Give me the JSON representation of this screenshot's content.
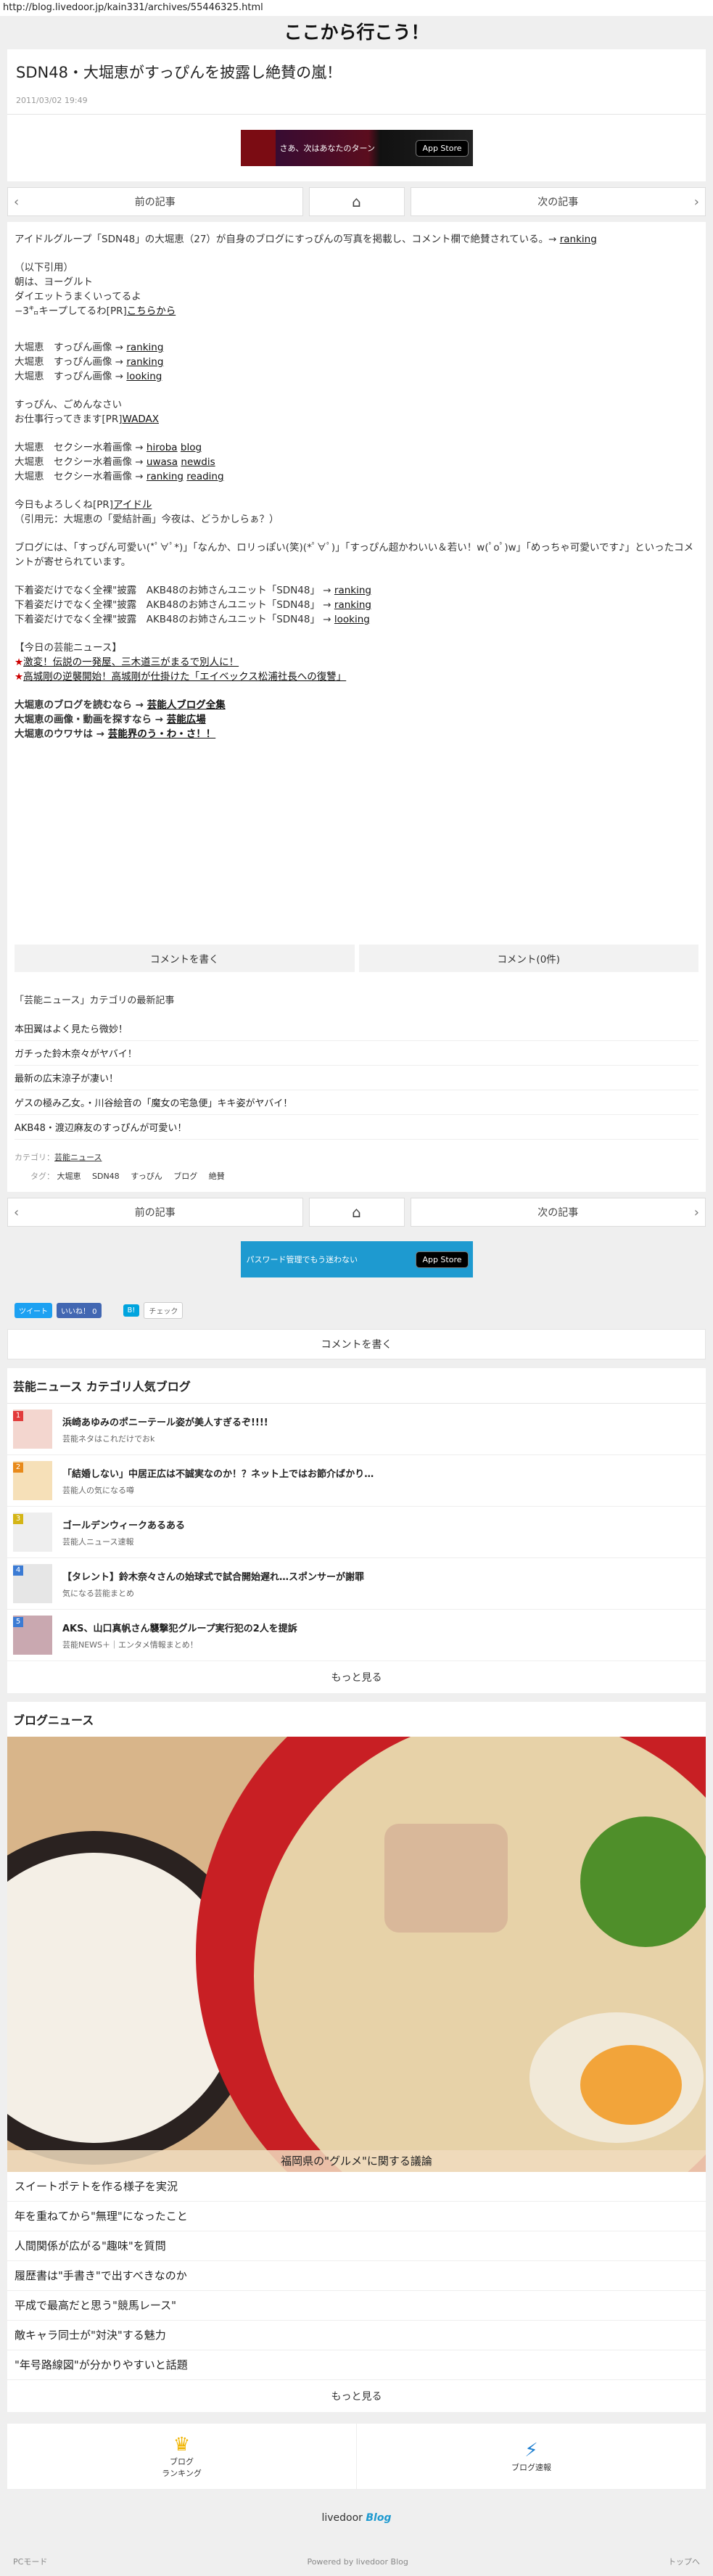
{
  "browser": {
    "url": "http://blog.livedoor.jp/kain331/archives/55446325.html"
  },
  "blog": {
    "title": "ここから行こう！"
  },
  "article": {
    "title": "SDN48・大堀恵がすっぴんを披露し絶賛の嵐！",
    "date": "2011/03/02 19:49"
  },
  "ads": {
    "top": {
      "text": "さあ、次はあなたのターン",
      "store": "App Store"
    },
    "bottom": {
      "text": "パスワード管理でもう迷わない",
      "store": "App Store"
    }
  },
  "pager": {
    "prev": "前の記事",
    "next": "次の記事",
    "home_icon": "home-icon"
  },
  "body": {
    "intro": "アイドルグループ「SDN48」の大堀恵（27）が自身のブログにすっぴんの写真を掲載し、コメント欄で絶賛されている。→",
    "intro_link": "ranking",
    "quote_head": "（以下引用）",
    "quote_1": "朝は、ヨーグルト",
    "quote_2": "ダイエットうまくいってるよ",
    "quote_3": "−3㌔キープしてるわ[PR]",
    "quote_3_link": "こちらから",
    "lines_a": [
      {
        "text": "大堀恵　すっぴん画像 →",
        "links": [
          "ranking"
        ]
      },
      {
        "text": "大堀恵　すっぴん画像 →",
        "links": [
          "ranking"
        ]
      },
      {
        "text": "大堀恵　すっぴん画像 →",
        "links": [
          "looking"
        ]
      }
    ],
    "apology_1": "すっぴん、ごめんなさい",
    "apology_2": "お仕事行ってきます[PR]",
    "apology_link": "WADAX",
    "lines_b": [
      {
        "text": "大堀恵　セクシー水着画像 →",
        "links": [
          "hiroba",
          "blog"
        ]
      },
      {
        "text": "大堀恵　セクシー水着画像 →",
        "links": [
          "uwasa",
          "newdis"
        ]
      },
      {
        "text": "大堀恵　セクシー水着画像 →",
        "links": [
          "ranking",
          "reading"
        ]
      }
    ],
    "today_1": "今日もよろしくね[PR]",
    "today_link": "アイドル",
    "today_2": "（引用元：大堀恵の「愛結計画」今夜は、どうかしらぁ？）",
    "comments": "ブログには、「すっぴん可愛い(*ﾟ∀ﾟ*)」「なんか、ロリっぽい(笑)(*ﾟ∀ﾟ)」「すっぴん超かわいい＆若い！w(ﾟoﾟ)w」「めっちゃ可愛いです♪」といったコメントが寄せられています。",
    "lines_c": [
      {
        "text": "下着姿だけでなく全裸\"披露　AKB48のお姉さんユニット「SDN48」 →",
        "links": [
          "ranking"
        ]
      },
      {
        "text": "下着姿だけでなく全裸\"披露　AKB48のお姉さんユニット「SDN48」 →",
        "links": [
          "ranking"
        ]
      },
      {
        "text": "下着姿だけでなく全裸\"披露　AKB48のお姉さんユニット「SDN48」 →",
        "links": [
          "looking"
        ]
      }
    ],
    "news_head": "【今日の芸能ニュース】",
    "news_1": "激変！伝説の一発屋、三木道三がまるで別人に！",
    "news_2": "高城剛の逆襲開始！高城剛が仕掛けた「エイベックス松浦社長への復讐」",
    "more_1_text": "大堀恵のブログを読むなら →",
    "more_1_link": "芸能人ブログ全集",
    "more_2_text": "大堀恵の画像・動画を探すなら →",
    "more_2_link": "芸能広場",
    "more_3_text": "大堀恵のウワサは →",
    "more_3_link": "芸能界のう・わ・さ！！"
  },
  "comment_buttons": {
    "write": "コメントを書く",
    "count": "コメント(0件)"
  },
  "recent": {
    "title": "「芸能ニュース」カテゴリの最新記事",
    "items": [
      "本田翼はよく見たら微妙！",
      "ガチった鈴木奈々がヤバイ！",
      "最新の広末涼子が凄い！",
      "ゲスの極み乙女。・川谷絵音の「魔女の宅急便」キキ姿がヤバイ！",
      "AKB48・渡辺麻友のすっぴんが可愛い！"
    ]
  },
  "meta": {
    "category_label": "カテゴリ：",
    "category": "芸能ニュース",
    "tag_label": "タグ：",
    "tags": [
      "大堀恵",
      "SDN48",
      "すっぴん",
      "ブログ",
      "絶賛"
    ]
  },
  "share": {
    "tweet": "ツイート",
    "like": "いいね！ 0",
    "hatena": "B!",
    "check": "チェック"
  },
  "comment_write": "コメントを書く",
  "popular": {
    "title": "芸能ニュース カテゴリ人気ブログ",
    "items": [
      {
        "rank": "1",
        "title": "浜崎あゆみのポニーテール姿が美人すぎるぞ!!!!",
        "sub": "芸能ネタはこれだけでおk",
        "rank_color": "#e23b3b"
      },
      {
        "rank": "2",
        "title": "「結婚しない」中居正広は不誠実なのか！？ネット上ではお節介ばかり…",
        "sub": "芸能人の気になる噂",
        "rank_color": "#e88a1a"
      },
      {
        "rank": "3",
        "title": "ゴールデンウィークあるある",
        "sub": "芸能人ニュース速報",
        "rank_color": "#d4b516"
      },
      {
        "rank": "4",
        "title": "【タレント】鈴木奈々さんの始球式で試合開始遅れ…スポンサーが謝罪",
        "sub": "気になる芸能まとめ",
        "rank_color": "#3b7bd4"
      },
      {
        "rank": "5",
        "title": "AKS、山口真帆さん襲撃犯グループ実行犯の2人を提訴",
        "sub": "芸能NEWS＋｜エンタメ情報まとめ！",
        "rank_color": "#3b7bd4"
      }
    ],
    "more": "もっと見る"
  },
  "blog_news": {
    "title": "ブログニュース",
    "photo_caption": "福岡県の\"グルメ\"に関する議論",
    "items": [
      "スイートポテトを作る様子を実況",
      "年を重ねてから\"無理\"になったこと",
      "人間関係が広がる\"趣味\"を質問",
      "履歴書は\"手書き\"で出すべきなのか",
      "平成で最高だと思う\"競馬レース\"",
      "敵キャラ同士が\"対決\"する魅力",
      "\"年号路線図\"が分かりやすいと話題"
    ],
    "more": "もっと見る"
  },
  "bottom_nav": {
    "ranking": "ブログ\nランキング",
    "ranking_icon": "crown-icon",
    "speed": "ブログ速報",
    "speed_icon": "lightning-icon"
  },
  "footer": {
    "logo_1": "livedoor",
    "logo_2": "Blog",
    "pc_mode": "PCモード",
    "powered": "Powered by livedoor Blog",
    "top": "トップへ"
  },
  "colors": {
    "accent_blue": "#1e9ad0",
    "rank_red": "#e23b3b",
    "crown": "#f0b400",
    "lightning": "#1e7fd0"
  }
}
